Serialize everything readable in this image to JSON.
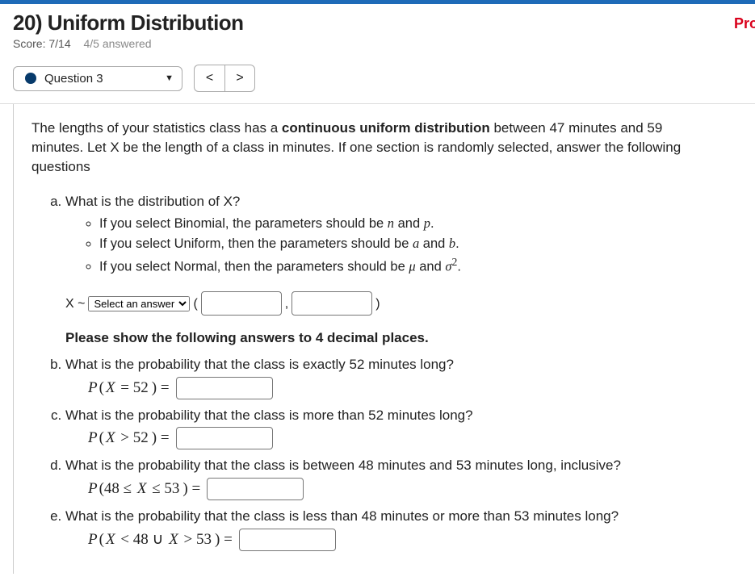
{
  "header": {
    "title": "20) Uniform Distribution",
    "score_label": "Score: 7/14",
    "answered_label": "4/5 answered",
    "right_badge": "Pro"
  },
  "nav": {
    "current_question": "Question 3"
  },
  "intro": {
    "pre": "The lengths of your statistics class has a ",
    "bold": "continuous uniform distribution",
    "post": " between 47 minutes and 59 minutes. Let X be the length of a class in minutes. If one section is randomly selected, answer the following questions"
  },
  "partA": {
    "prompt": "What is the distribution of X?",
    "hint_binomial_pre": "If you select Binomial, the parameters should be ",
    "hint_binomial_n": "n",
    "hint_binomial_and": " and ",
    "hint_binomial_p": "p",
    "hint_binomial_post": ".",
    "hint_uniform_pre": "If you select Uniform, then the parameters should be ",
    "hint_uniform_a": "a",
    "hint_uniform_and": " and ",
    "hint_uniform_b": "b",
    "hint_uniform_post": ".",
    "hint_normal_pre": "If you select Normal, then the parameters should be ",
    "hint_normal_mu": "μ",
    "hint_normal_and": " and ",
    "hint_normal_sigma": "σ",
    "hint_normal_sup": "2",
    "hint_normal_post": ".",
    "xlabel": "X ~",
    "select_placeholder": "Select an answer",
    "lparen": "(",
    "comma": ",",
    "rparen": ")"
  },
  "decimal_note": "Please show the following answers to 4 decimal places.",
  "partB": {
    "prompt": "What is the probability that the class is exactly 52 minutes long?",
    "expr_p": "P",
    "expr_open": "(",
    "expr_var": "X",
    "expr_rel": " = 52",
    "expr_close": ") ="
  },
  "partC": {
    "prompt": "What is the probability that the class is more than 52 minutes long?",
    "expr_p": "P",
    "expr_open": "(",
    "expr_var": "X",
    "expr_rel": " > 52",
    "expr_close": ") ="
  },
  "partD": {
    "prompt": "What is the probability that the class is between 48 minutes and 53 minutes long, inclusive?",
    "expr_p": "P",
    "expr_open": "(48 ≤ ",
    "expr_var": "X",
    "expr_rel": " ≤ 53",
    "expr_close": ") ="
  },
  "partE": {
    "prompt": "What is the probability that the class is less than 48 minutes or more than 53 minutes long?",
    "expr_p": "P",
    "expr_open": "(",
    "expr_var": "X",
    "expr_rel1": " < 48 ∪ ",
    "expr_var2": "X",
    "expr_rel2": " > 53",
    "expr_close": ") ="
  }
}
